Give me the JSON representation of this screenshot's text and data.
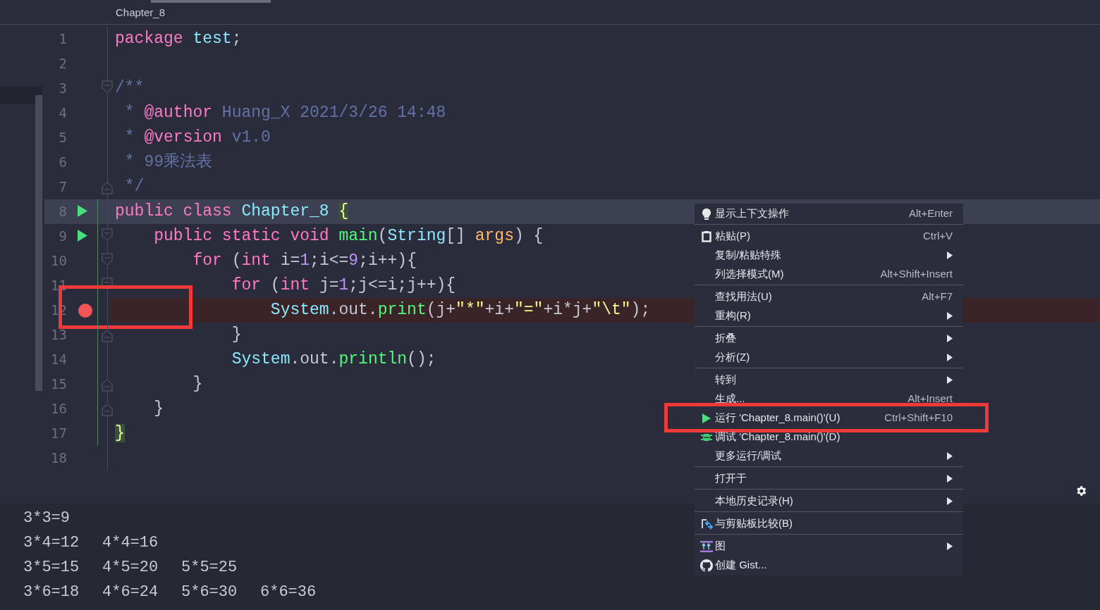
{
  "tab": {
    "title": "Chapter_8"
  },
  "editor": {
    "lines": [
      {
        "number": "1",
        "tokens": [
          {
            "kind": "keyword",
            "text": "package "
          },
          {
            "kind": "type",
            "text": "test"
          },
          {
            "kind": "plain",
            "text": ";"
          }
        ]
      },
      {
        "number": "2"
      },
      {
        "number": "3",
        "fold_start": true,
        "tokens": [
          {
            "kind": "comment",
            "text": "/**"
          }
        ]
      },
      {
        "number": "4",
        "tokens": [
          {
            "kind": "comment",
            "text": " * "
          },
          {
            "kind": "tag",
            "text": "@author"
          },
          {
            "kind": "comment",
            "text": " Huang_X 2021/3/26 14:48"
          }
        ]
      },
      {
        "number": "5",
        "tokens": [
          {
            "kind": "comment",
            "text": " * "
          },
          {
            "kind": "tag",
            "text": "@version"
          },
          {
            "kind": "comment",
            "text": " v1.0"
          }
        ]
      },
      {
        "number": "6",
        "tokens": [
          {
            "kind": "comment",
            "text": " * 99乘法表"
          }
        ]
      },
      {
        "number": "7",
        "fold_end": true,
        "tokens": [
          {
            "kind": "comment",
            "text": " */"
          }
        ]
      },
      {
        "number": "8",
        "run": true,
        "current": true,
        "changed": true,
        "tokens": [
          {
            "kind": "keyword",
            "text": "public class "
          },
          {
            "kind": "type",
            "text": "Chapter_8 "
          },
          {
            "kind": "brace",
            "text": "{",
            "matched": true
          }
        ]
      },
      {
        "number": "9",
        "run": true,
        "fold_start": true,
        "changed": true,
        "tokens": [
          {
            "kind": "keyword",
            "text": "    public static void "
          },
          {
            "kind": "function",
            "text": "main"
          },
          {
            "kind": "plain",
            "text": "("
          },
          {
            "kind": "type",
            "text": "String"
          },
          {
            "kind": "plain",
            "text": "[] "
          },
          {
            "kind": "param",
            "text": "args"
          },
          {
            "kind": "plain",
            "text": ") {"
          }
        ]
      },
      {
        "number": "10",
        "fold_start": true,
        "changed": true,
        "tokens": [
          {
            "kind": "keyword",
            "text": "        for"
          },
          {
            "kind": "plain",
            "text": " ("
          },
          {
            "kind": "keyword",
            "text": "int"
          },
          {
            "kind": "plain",
            "text": " i="
          },
          {
            "kind": "number",
            "text": "1"
          },
          {
            "kind": "plain",
            "text": ";i<="
          },
          {
            "kind": "number",
            "text": "9"
          },
          {
            "kind": "plain",
            "text": ";i++){"
          }
        ]
      },
      {
        "number": "11",
        "fold_start": true,
        "changed": true,
        "tokens": [
          {
            "kind": "keyword",
            "text": "            for"
          },
          {
            "kind": "plain",
            "text": " ("
          },
          {
            "kind": "keyword",
            "text": "int"
          },
          {
            "kind": "plain",
            "text": " j="
          },
          {
            "kind": "number",
            "text": "1"
          },
          {
            "kind": "plain",
            "text": ";j<=i;j++){"
          }
        ]
      },
      {
        "number": "12",
        "breakpoint": true,
        "annotated": true,
        "changed": true,
        "tokens": [
          {
            "kind": "type",
            "text": "                System"
          },
          {
            "kind": "plain",
            "text": ".out."
          },
          {
            "kind": "function",
            "text": "print"
          },
          {
            "kind": "plain",
            "text": "(j+"
          },
          {
            "kind": "string",
            "text": "\"*\""
          },
          {
            "kind": "plain",
            "text": "+i+"
          },
          {
            "kind": "string",
            "text": "\"=\""
          },
          {
            "kind": "plain",
            "text": "+i*j+"
          },
          {
            "kind": "string",
            "text": "\"\\t\""
          },
          {
            "kind": "plain",
            "text": ");"
          }
        ]
      },
      {
        "number": "13",
        "fold_end": true,
        "changed": true,
        "tokens": [
          {
            "kind": "plain",
            "text": "            }"
          }
        ]
      },
      {
        "number": "14",
        "changed": true,
        "tokens": [
          {
            "kind": "type",
            "text": "            System"
          },
          {
            "kind": "plain",
            "text": ".out."
          },
          {
            "kind": "function",
            "text": "println"
          },
          {
            "kind": "plain",
            "text": "();"
          }
        ]
      },
      {
        "number": "15",
        "fold_end": true,
        "changed": true,
        "tokens": [
          {
            "kind": "plain",
            "text": "        }"
          }
        ]
      },
      {
        "number": "16",
        "fold_end": true,
        "changed": true,
        "tokens": [
          {
            "kind": "plain",
            "text": "    }"
          }
        ]
      },
      {
        "number": "17",
        "changed": true,
        "tokens": [
          {
            "kind": "brace",
            "text": "}",
            "matched": true
          }
        ]
      },
      {
        "number": "18"
      }
    ]
  },
  "context_menu": {
    "items": [
      {
        "kind": "bulb",
        "label": "显示上下文操作",
        "shortcut": "Alt+Enter",
        "separator_after": true
      },
      {
        "kind": "clipboard",
        "label": "粘贴(P)",
        "shortcut": "Ctrl+V"
      },
      {
        "kind": "plain",
        "label": "复制/粘贴特殊",
        "submenu": true
      },
      {
        "kind": "plain",
        "label": "列选择模式(M)",
        "shortcut": "Alt+Shift+Insert",
        "separator_after": true
      },
      {
        "kind": "plain",
        "label": "查找用法(U)",
        "shortcut": "Alt+F7"
      },
      {
        "kind": "plain",
        "label": "重构(R)",
        "submenu": true,
        "separator_after": true
      },
      {
        "kind": "plain",
        "label": "折叠",
        "submenu": true
      },
      {
        "kind": "plain",
        "label": "分析(Z)",
        "submenu": true,
        "separator_after": true
      },
      {
        "kind": "plain",
        "label": "转到",
        "submenu": true
      },
      {
        "kind": "plain",
        "label": "生成...",
        "shortcut": "Alt+Insert"
      },
      {
        "kind": "run",
        "label": "运行 'Chapter_8.main()'(U)",
        "shortcut": "Ctrl+Shift+F10",
        "highlighted": true
      },
      {
        "kind": "debug",
        "label": "调试 'Chapter_8.main()'(D)"
      },
      {
        "kind": "plain",
        "label": "更多运行/调试",
        "submenu": true,
        "separator_after": true
      },
      {
        "kind": "plain",
        "label": "打开于",
        "submenu": true,
        "separator_after": true
      },
      {
        "kind": "plain",
        "label": "本地历史记录(H)",
        "submenu": true,
        "separator_after": true
      },
      {
        "kind": "compare",
        "label": "与剪贴板比较(B)",
        "separator_after": true
      },
      {
        "kind": "diagram",
        "label": "图",
        "submenu": true
      },
      {
        "kind": "gist",
        "label": "创建 Gist..."
      }
    ]
  },
  "console": {
    "rows": [
      [
        "3*3=9"
      ],
      [
        "3*4=12",
        "4*4=16"
      ],
      [
        "3*5=15",
        "4*5=20",
        "5*5=25"
      ],
      [
        "3*6=18",
        "4*6=24",
        "5*6=30",
        "6*6=36"
      ]
    ]
  }
}
